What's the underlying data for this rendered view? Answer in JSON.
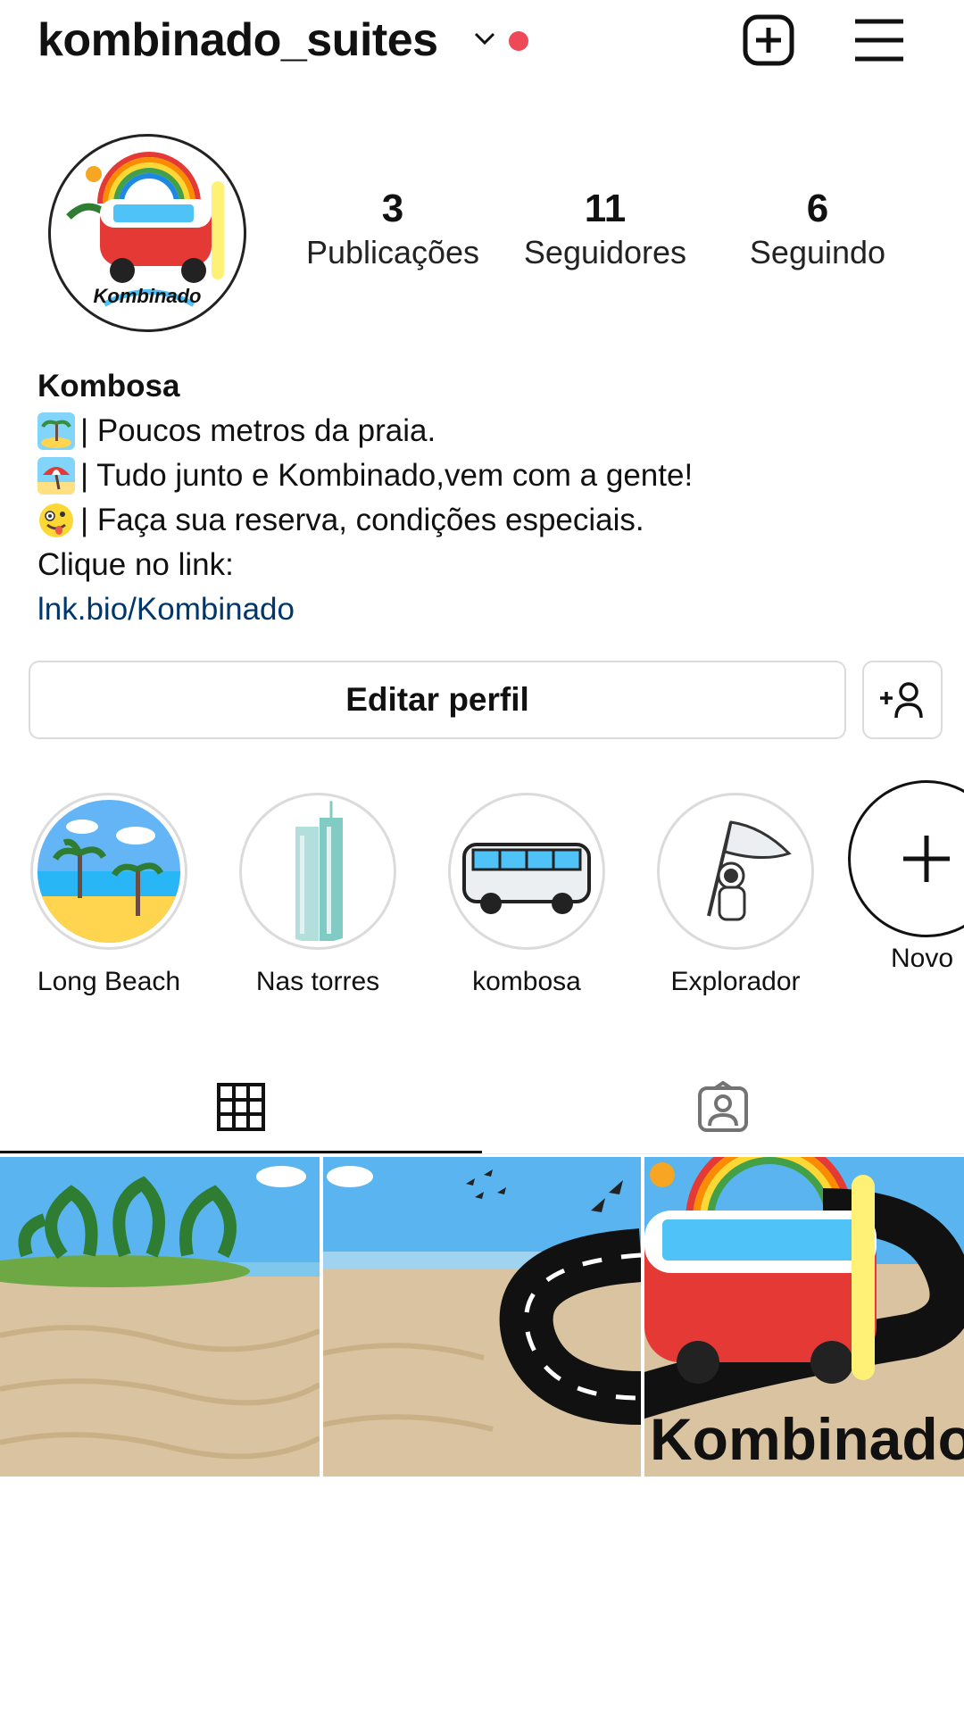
{
  "header": {
    "username": "kombinado_suites",
    "chevron_icon": "chevron-down-icon",
    "notification_dot_color": "#ed4956",
    "new_post_icon": "plus-square-icon",
    "menu_icon": "hamburger-menu-icon"
  },
  "profile": {
    "avatar_text": "Kombinado",
    "stats": [
      {
        "value": "3",
        "label": "Publicações"
      },
      {
        "value": "11",
        "label": "Seguidores"
      },
      {
        "value": "6",
        "label": "Seguindo"
      }
    ]
  },
  "bio": {
    "name": "Kombosa",
    "lines": [
      {
        "emoji": "beach-island-emoji",
        "text": "| Poucos metros da praia."
      },
      {
        "emoji": "beach-umbrella-emoji",
        "text": "| Tudo junto e Kombinado,vem com a gente!"
      },
      {
        "emoji": "zany-face-emoji",
        "text": "| Faça sua reserva, condições especiais."
      }
    ],
    "cta": "Clique no link:",
    "link": "lnk.bio/Kombinado",
    "link_color": "#00376b"
  },
  "actions": {
    "edit_profile": "Editar perfil",
    "add_person_icon": "add-person-icon"
  },
  "highlights": [
    {
      "label": "Long Beach"
    },
    {
      "label": "Nas torres"
    },
    {
      "label": "kombosa"
    },
    {
      "label": "Explorador"
    },
    {
      "label": "Novo"
    }
  ],
  "tabs": [
    {
      "name": "grid",
      "icon": "grid-icon",
      "active": true
    },
    {
      "name": "tagged",
      "icon": "tagged-person-icon",
      "active": false
    }
  ],
  "posts": [
    {
      "description": "palm trees on sandy beach"
    },
    {
      "description": "road with birds on sand"
    },
    {
      "description": "van on road",
      "text": "Kombinado"
    }
  ]
}
